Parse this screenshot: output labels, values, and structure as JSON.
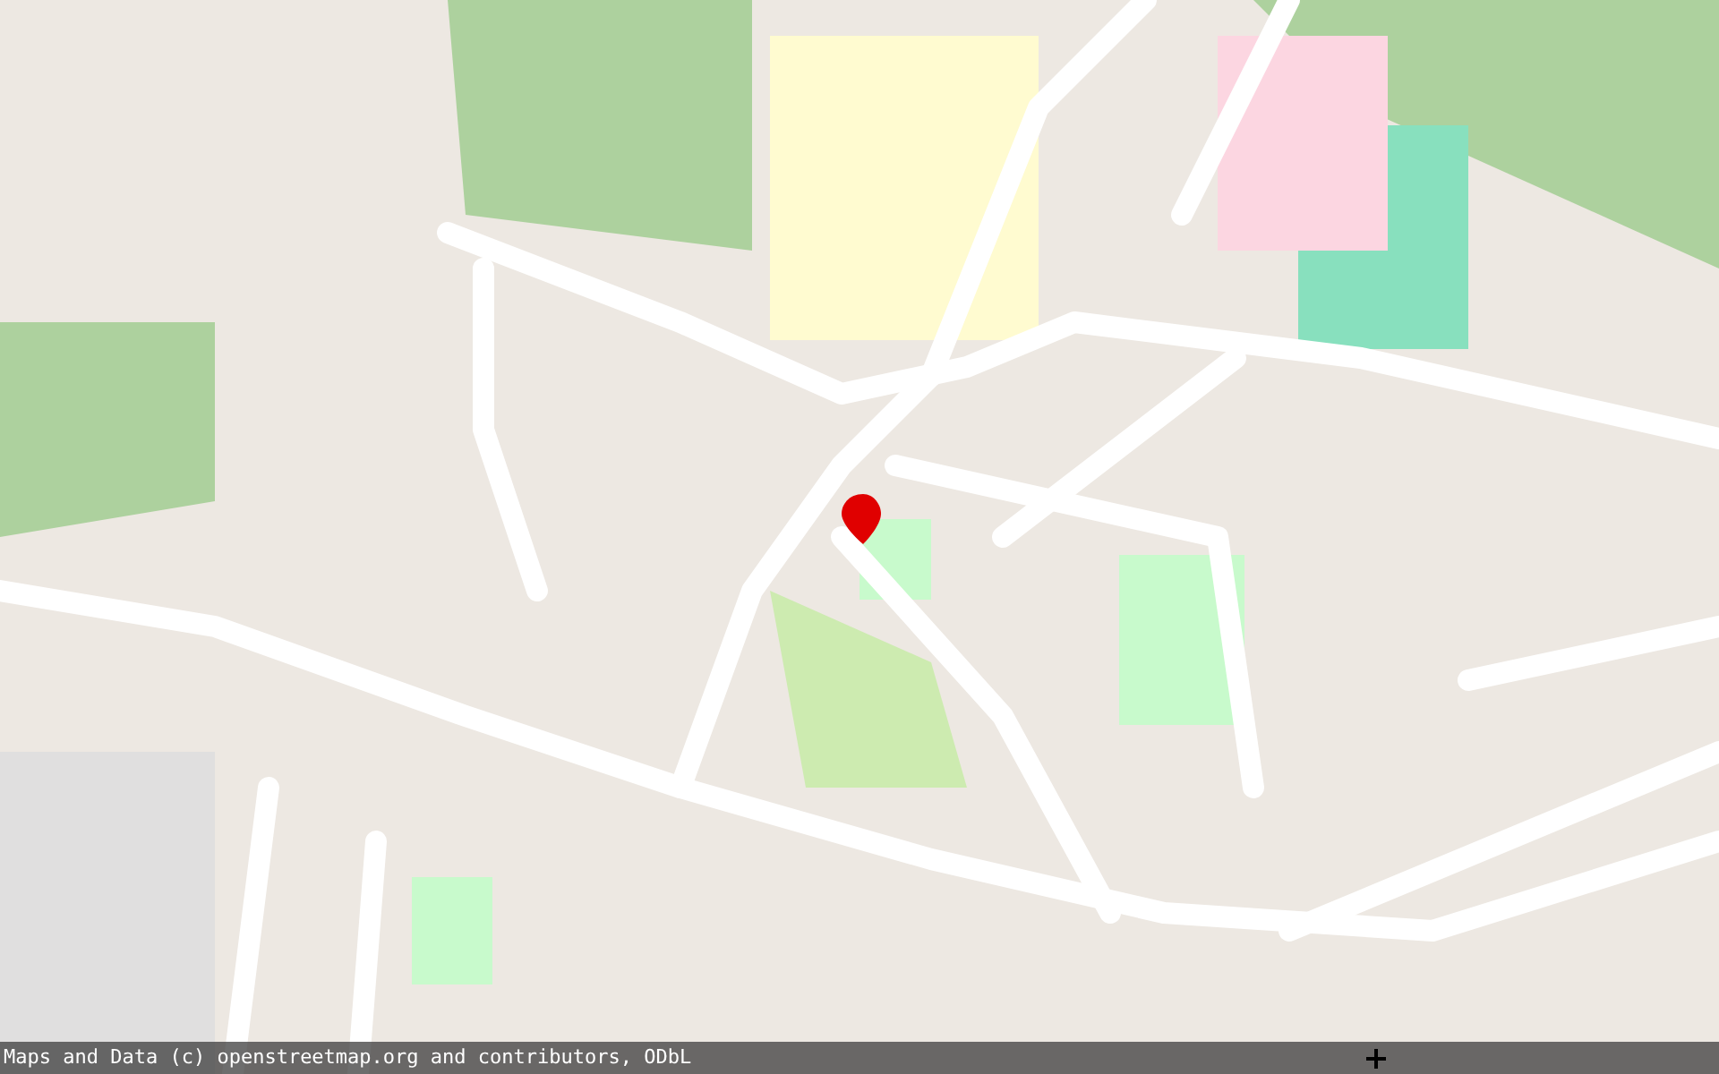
{
  "map": {
    "attribution": "Maps and Data (c) openstreetmap.org and contributors, ODbL"
  }
}
